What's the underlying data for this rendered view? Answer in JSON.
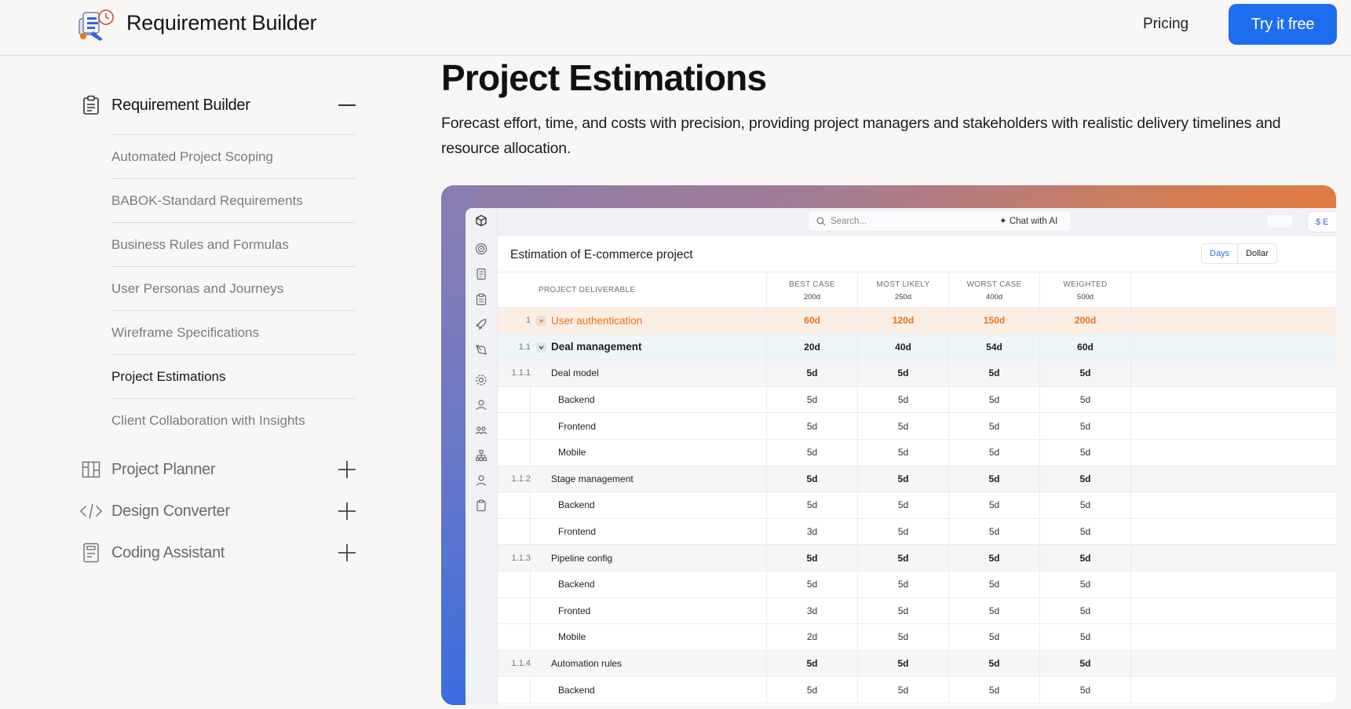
{
  "header": {
    "brand": "Requirement Builder",
    "logo_icon": "robot-mascot-icon",
    "pricing_label": "Pricing",
    "cta_label": "Try it free"
  },
  "sidebar": {
    "sections": [
      {
        "label": "Requirement Builder",
        "icon": "clipboard-icon",
        "toggle": "minus-icon",
        "expanded": true
      },
      {
        "label": "Project Planner",
        "icon": "kanban-icon",
        "toggle": "plus-icon",
        "expanded": false
      },
      {
        "label": "Design Converter",
        "icon": "code-icon",
        "toggle": "plus-icon",
        "expanded": false
      },
      {
        "label": "Coding Assistant",
        "icon": "document-icon",
        "toggle": "plus-icon",
        "expanded": false
      }
    ],
    "sub_items": [
      "Automated Project Scoping",
      "BABOK-Standard Requirements",
      "Business Rules and Formulas",
      "User Personas and Journeys",
      "Wireframe Specifications",
      "Project Estimations",
      "Client Collaboration with Insights"
    ],
    "current_sub_item": "Project Estimations"
  },
  "main": {
    "title": "Project Estimations",
    "description": "Forecast effort, time, and costs with precision, providing project managers and stakeholders with realistic delivery timelines and resource allocation."
  },
  "app": {
    "search_placeholder": "Search...",
    "chat_label": "✦ Chat with AI",
    "top_pill_label": "$ E",
    "estimation_title": "Estimation of E-commerce project",
    "unit_toggle": {
      "active": "Days",
      "inactive": "Dollar"
    },
    "colors": {
      "accent": "#1e6cf0",
      "highlight_orange": "#e8741e",
      "row_orange_bg": "#fdeee4",
      "row_blue_bg": "#eef6fa"
    },
    "table": {
      "deliverable_header": "PROJECT DELIVERABLE",
      "columns": [
        {
          "label": "BEST CASE",
          "total": "200d"
        },
        {
          "label": "MOST LIKELY",
          "total": "250d"
        },
        {
          "label": "WORST CASE",
          "total": "400d"
        },
        {
          "label": "WEIGHTED",
          "total": "500d"
        }
      ],
      "rows": [
        {
          "level": 0,
          "num": "1",
          "name": "User authentication",
          "values": [
            "60d",
            "120d",
            "150d",
            "200d"
          ]
        },
        {
          "level": 1,
          "num": "1.1",
          "name": "Deal management",
          "values": [
            "20d",
            "40d",
            "54d",
            "60d"
          ]
        },
        {
          "level": 2,
          "num": "1.1.1",
          "name": "Deal model",
          "values": [
            "5d",
            "5d",
            "5d",
            "5d"
          ]
        },
        {
          "level": 3,
          "num": "",
          "name": "Backend",
          "values": [
            "5d",
            "5d",
            "5d",
            "5d"
          ]
        },
        {
          "level": 3,
          "num": "",
          "name": "Frontend",
          "values": [
            "5d",
            "5d",
            "5d",
            "5d"
          ]
        },
        {
          "level": 3,
          "num": "",
          "name": "Mobile",
          "values": [
            "5d",
            "5d",
            "5d",
            "5d"
          ]
        },
        {
          "level": 2,
          "num": "1.1.2",
          "name": "Stage management",
          "values": [
            "5d",
            "5d",
            "5d",
            "5d"
          ]
        },
        {
          "level": 3,
          "num": "",
          "name": "Backend",
          "values": [
            "5d",
            "5d",
            "5d",
            "5d"
          ]
        },
        {
          "level": 3,
          "num": "",
          "name": "Frontend",
          "values": [
            "3d",
            "5d",
            "5d",
            "5d"
          ]
        },
        {
          "level": 2,
          "num": "1.1.3",
          "name": "Pipeline config",
          "values": [
            "5d",
            "5d",
            "5d",
            "5d"
          ]
        },
        {
          "level": 3,
          "num": "",
          "name": "Backend",
          "values": [
            "5d",
            "5d",
            "5d",
            "5d"
          ]
        },
        {
          "level": 3,
          "num": "",
          "name": "Fronted",
          "values": [
            "3d",
            "5d",
            "5d",
            "5d"
          ]
        },
        {
          "level": 3,
          "num": "",
          "name": "Mobile",
          "values": [
            "2d",
            "5d",
            "5d",
            "5d"
          ]
        },
        {
          "level": 2,
          "num": "1.1.4",
          "name": "Automation rules",
          "values": [
            "5d",
            "5d",
            "5d",
            "5d"
          ]
        },
        {
          "level": 3,
          "num": "",
          "name": "Backend",
          "values": [
            "5d",
            "5d",
            "5d",
            "5d"
          ]
        }
      ]
    },
    "rail_icons": [
      "cube-icon",
      "target-icon",
      "document-icon",
      "clipboard-icon",
      "rocket-icon",
      "pen-icon",
      "settings-icon",
      "users-icon",
      "team-icon",
      "hierarchy-icon",
      "person-icon",
      "clipboard-blank-icon"
    ]
  }
}
